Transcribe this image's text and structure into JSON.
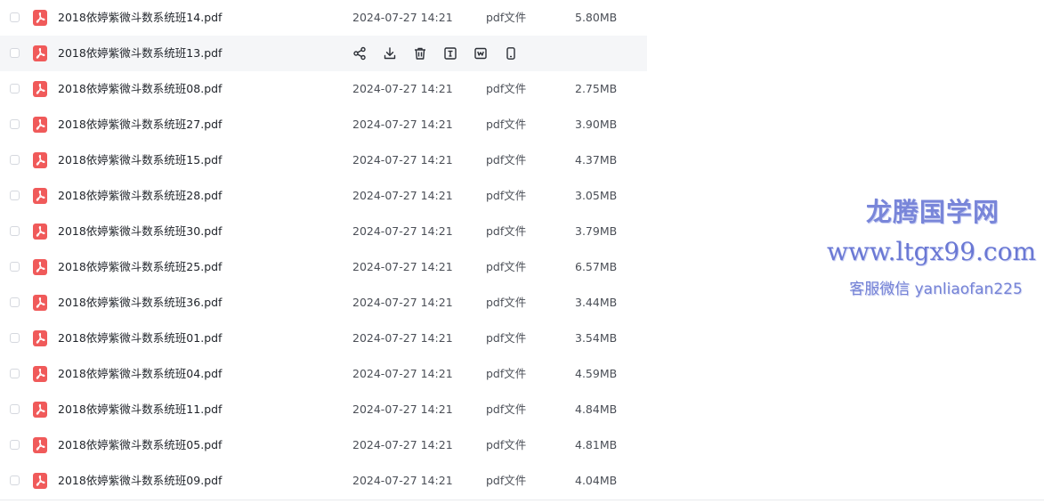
{
  "files": [
    {
      "name": "2018依婷紫微斗数系统班14.pdf",
      "date": "2024-07-27 14:21",
      "type": "pdf文件",
      "size": "5.80MB",
      "hover": false
    },
    {
      "name": "2018依婷紫微斗数系统班13.pdf",
      "date": "",
      "type": "",
      "size": "",
      "hover": true
    },
    {
      "name": "2018依婷紫微斗数系统班08.pdf",
      "date": "2024-07-27 14:21",
      "type": "pdf文件",
      "size": "2.75MB",
      "hover": false
    },
    {
      "name": "2018依婷紫微斗数系统班27.pdf",
      "date": "2024-07-27 14:21",
      "type": "pdf文件",
      "size": "3.90MB",
      "hover": false
    },
    {
      "name": "2018依婷紫微斗数系统班15.pdf",
      "date": "2024-07-27 14:21",
      "type": "pdf文件",
      "size": "4.37MB",
      "hover": false
    },
    {
      "name": "2018依婷紫微斗数系统班28.pdf",
      "date": "2024-07-27 14:21",
      "type": "pdf文件",
      "size": "3.05MB",
      "hover": false
    },
    {
      "name": "2018依婷紫微斗数系统班30.pdf",
      "date": "2024-07-27 14:21",
      "type": "pdf文件",
      "size": "3.79MB",
      "hover": false
    },
    {
      "name": "2018依婷紫微斗数系统班25.pdf",
      "date": "2024-07-27 14:21",
      "type": "pdf文件",
      "size": "6.57MB",
      "hover": false
    },
    {
      "name": "2018依婷紫微斗数系统班36.pdf",
      "date": "2024-07-27 14:21",
      "type": "pdf文件",
      "size": "3.44MB",
      "hover": false
    },
    {
      "name": "2018依婷紫微斗数系统班01.pdf",
      "date": "2024-07-27 14:21",
      "type": "pdf文件",
      "size": "3.54MB",
      "hover": false
    },
    {
      "name": "2018依婷紫微斗数系统班04.pdf",
      "date": "2024-07-27 14:21",
      "type": "pdf文件",
      "size": "4.59MB",
      "hover": false
    },
    {
      "name": "2018依婷紫微斗数系统班11.pdf",
      "date": "2024-07-27 14:21",
      "type": "pdf文件",
      "size": "4.84MB",
      "hover": false
    },
    {
      "name": "2018依婷紫微斗数系统班05.pdf",
      "date": "2024-07-27 14:21",
      "type": "pdf文件",
      "size": "4.81MB",
      "hover": false
    },
    {
      "name": "2018依婷紫微斗数系统班09.pdf",
      "date": "2024-07-27 14:21",
      "type": "pdf文件",
      "size": "4.04MB",
      "hover": false
    }
  ],
  "row_actions": [
    {
      "icon": "share-icon"
    },
    {
      "icon": "download-icon"
    },
    {
      "icon": "trash-icon"
    },
    {
      "icon": "rename-icon"
    },
    {
      "icon": "save-to-cloud-icon"
    },
    {
      "icon": "send-to-phone-icon"
    }
  ],
  "watermark": {
    "title": "龙腾国学网",
    "url": "www.ltgx99.com",
    "wechat": "客服微信 yanliaofan225"
  },
  "colors": {
    "pdf_icon": "#f05a5a",
    "hover_row": "#f5f6f8",
    "watermark": "#6f7fd6"
  }
}
